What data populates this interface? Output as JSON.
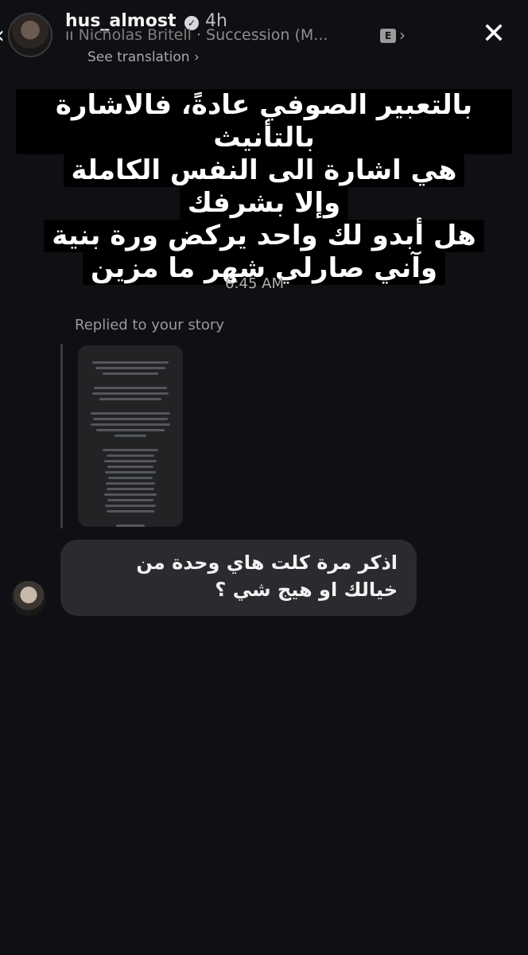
{
  "header": {
    "username": "hus_almost",
    "time_ago": "4h",
    "music_artist": "Nicholas Britell",
    "music_title": "· Succession (M...",
    "explicit_badge": "E",
    "see_translation": "See translation"
  },
  "story_caption": {
    "lines": [
      "بالتعبير الصوفي عادةً، فالاشارة بالتأنيث",
      "هي اشارة الى النفس الكاملة",
      "وإلا بشرفك",
      "هل أبدو لك واحد يركض ورة بنية",
      "وآني صارلي شهر ما مزين"
    ]
  },
  "conversation": {
    "timestamp": "6:45 AM",
    "replied_label": "Replied to your story",
    "message_text": "اذكر مرة كلت هاي وحدة من خيالك او هيج شي ؟"
  },
  "icons": {
    "back": "back-arrow-icon",
    "close": "close-icon",
    "verified": "verified-badge-icon",
    "music": "music-bars-icon",
    "translate": "translate-icon"
  },
  "colors": {
    "background": "#0f1013",
    "bubble": "#2a2b2e",
    "caption_bg": "#000000"
  }
}
